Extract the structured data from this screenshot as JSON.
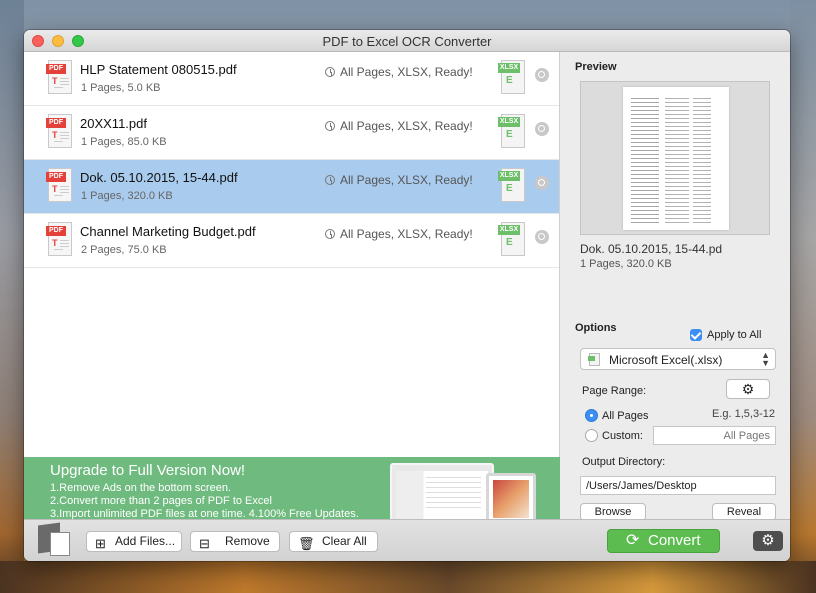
{
  "window": {
    "title": "PDF to Excel OCR Converter"
  },
  "files": [
    {
      "name": "HLP Statement 080515.pdf",
      "meta": "1 Pages, 5.0 KB",
      "status": "All Pages, XLSX, Ready!",
      "selected": false
    },
    {
      "name": "20XX11.pdf",
      "meta": "1 Pages, 85.0 KB",
      "status": "All Pages, XLSX, Ready!",
      "selected": false
    },
    {
      "name": "Dok. 05.10.2015, 15-44.pdf",
      "meta": "1 Pages, 320.0 KB",
      "status": "All Pages, XLSX, Ready!",
      "selected": true
    },
    {
      "name": "Channel Marketing Budget.pdf",
      "meta": "2 Pages, 75.0 KB",
      "status": "All Pages, XLSX, Ready!",
      "selected": false
    }
  ],
  "icons": {
    "pdf_tag": "PDF",
    "pdf_letter": "T",
    "xlsx_tag": "XLSX",
    "xlsx_letter": "E"
  },
  "banner": {
    "title": "Upgrade to Full Version Now!",
    "lines": [
      "1.Remove Ads on the bottom screen.",
      "2.Convert more than 2 pages of PDF to Excel",
      "3.Import unlimited PDF files at one time. 4.100% Free Updates."
    ]
  },
  "preview": {
    "heading": "Preview",
    "file_name": "Dok. 05.10.2015, 15-44.pd",
    "file_meta": "1 Pages, 320.0 KB"
  },
  "options": {
    "heading": "Options",
    "apply_all_label": "Apply to All",
    "apply_all_checked": true,
    "format_selected": "Microsoft Excel(.xlsx)",
    "page_range_label": "Page Range:",
    "all_pages_label": "All Pages",
    "example_hint": "E.g. 1,5,3-12",
    "custom_label": "Custom:",
    "custom_placeholder": "All Pages",
    "output_dir_label": "Output Directory:",
    "output_dir_value": "/Users/James/Desktop",
    "browse_label": "Browse",
    "reveal_label": "Reveal"
  },
  "toolbar": {
    "add_files_label": "Add Files...",
    "remove_label": "Remove",
    "clear_all_label": "Clear All",
    "convert_label": "Convert"
  },
  "colors": {
    "accent": "#3b8ef3",
    "convert_green": "#5dbc50",
    "banner_green": "#6fbb7f",
    "selected_row": "#a9cbed"
  }
}
